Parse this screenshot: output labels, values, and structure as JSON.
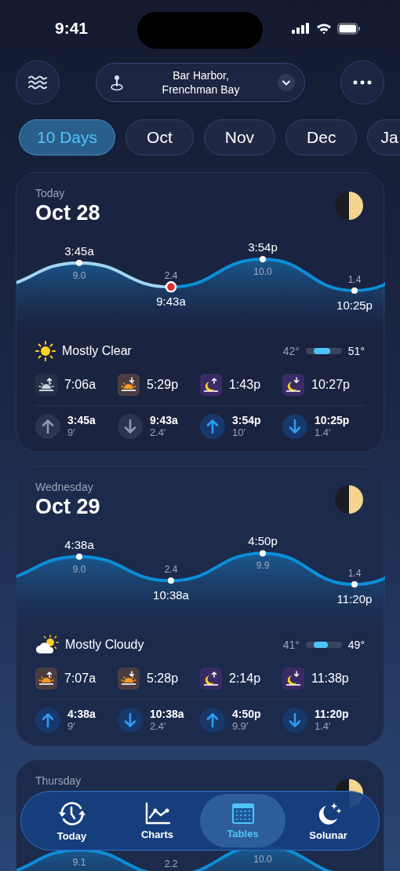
{
  "status_bar": {
    "time": "9:41"
  },
  "location": {
    "line1": "Bar Harbor,",
    "line2": "Frenchman Bay"
  },
  "tabs": [
    {
      "label": "10 Days",
      "selected": true
    },
    {
      "label": "Oct",
      "selected": false
    },
    {
      "label": "Nov",
      "selected": false
    },
    {
      "label": "Dec",
      "selected": false
    },
    {
      "label": "Ja",
      "selected": false
    }
  ],
  "days": [
    {
      "day": "Today",
      "date": "Oct 28",
      "tide_points": [
        {
          "kind": "high",
          "time": "3:45a",
          "reading": "9.0",
          "current": false
        },
        {
          "kind": "low",
          "time": "9:43a",
          "reading": "2.4",
          "current": true
        },
        {
          "kind": "high",
          "time": "3:54p",
          "reading": "10.0",
          "current": false
        },
        {
          "kind": "low",
          "time": "10:25p",
          "reading": "1.4",
          "current": false
        }
      ],
      "weather": {
        "kind": "clear",
        "text": "Mostly Clear",
        "low": "42°",
        "high": "51°",
        "level": 0.45
      },
      "sun_moon": [
        {
          "kind": "sunrise",
          "time": "7:06a",
          "past": true
        },
        {
          "kind": "sunset",
          "time": "5:29p",
          "past": false
        },
        {
          "kind": "moonrise",
          "time": "1:43p",
          "past": false
        },
        {
          "kind": "moonset",
          "time": "10:27p",
          "past": false
        }
      ],
      "tides": [
        {
          "kind": "high",
          "time": "3:45a",
          "reading": "9′",
          "past": true
        },
        {
          "kind": "low",
          "time": "9:43a",
          "reading": "2.4′",
          "past": true
        },
        {
          "kind": "high",
          "time": "3:54p",
          "reading": "10′",
          "past": false
        },
        {
          "kind": "low",
          "time": "10:25p",
          "reading": "1.4′",
          "past": false
        }
      ]
    },
    {
      "day": "Wednesday",
      "date": "Oct 29",
      "tide_points": [
        {
          "kind": "high",
          "time": "4:38a",
          "reading": "9.0",
          "current": false
        },
        {
          "kind": "low",
          "time": "10:38a",
          "reading": "2.4",
          "current": false
        },
        {
          "kind": "high",
          "time": "4:50p",
          "reading": "9.9",
          "current": false
        },
        {
          "kind": "low",
          "time": "11:20p",
          "reading": "1.4",
          "current": false
        }
      ],
      "weather": {
        "kind": "cloudy",
        "text": "Mostly Cloudy",
        "low": "41°",
        "high": "49°",
        "level": 0.4
      },
      "sun_moon": [
        {
          "kind": "sunrise",
          "time": "7:07a",
          "past": false
        },
        {
          "kind": "sunset",
          "time": "5:28p",
          "past": false
        },
        {
          "kind": "moonrise",
          "time": "2:14p",
          "past": false
        },
        {
          "kind": "moonset",
          "time": "11:38p",
          "past": false
        }
      ],
      "tides": [
        {
          "kind": "high",
          "time": "4:38a",
          "reading": "9′",
          "past": false
        },
        {
          "kind": "low",
          "time": "10:38a",
          "reading": "2.4′",
          "past": false
        },
        {
          "kind": "high",
          "time": "4:50p",
          "reading": "9.9′",
          "past": false
        },
        {
          "kind": "low",
          "time": "11:20p",
          "reading": "1.4′",
          "past": false
        }
      ]
    },
    {
      "day": "Thursday",
      "tide_points": [
        {
          "kind": "high",
          "reading": "9.1"
        },
        {
          "kind": "low",
          "reading": "2.2"
        },
        {
          "kind": "high",
          "reading": "10.0"
        }
      ]
    }
  ],
  "nav": [
    {
      "kind": "today",
      "label": "Today",
      "selected": false
    },
    {
      "kind": "charts",
      "label": "Charts",
      "selected": false
    },
    {
      "kind": "tables",
      "label": "Tables",
      "selected": true
    },
    {
      "kind": "solunar",
      "label": "Solunar",
      "selected": false
    }
  ]
}
